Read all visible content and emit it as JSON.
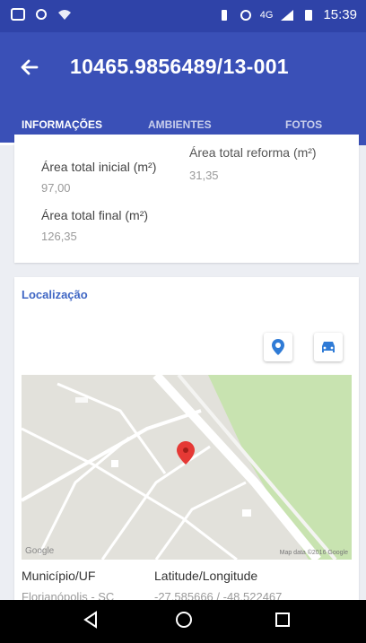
{
  "statusbar": {
    "time": "15:39",
    "network": "4G"
  },
  "appbar": {
    "back_icon": "arrow-left-icon",
    "title": "10465.9856489/13-001"
  },
  "tabs": [
    {
      "label": "INFORMAÇÕES",
      "active": true
    },
    {
      "label": "AMBIENTES",
      "active": false
    },
    {
      "label": "FOTOS",
      "active": false
    }
  ],
  "info": {
    "area_reforma_label": "Área total reforma (m²)",
    "area_reforma_value": "31,35",
    "area_inicial_label": "Área total inicial (m²)",
    "area_inicial_value": "97,00",
    "area_final_label": "Área total final (m²)",
    "area_final_value": "126,35"
  },
  "location": {
    "title": "Localização",
    "pin_icon": "map-pin-icon",
    "car_icon": "car-icon",
    "google_label": "Google",
    "map_credit": "Map data ©2016 Google",
    "municipio_label": "Município/UF",
    "municipio_value": "Florianópolis - SC",
    "latlong_label": "Latitude/Longitude",
    "latlong_value": "-27.585666 / -48.522467"
  },
  "colors": {
    "primary": "#3a50b7",
    "primary_dark": "#2f43a8",
    "accent": "#3f66c4",
    "pin": "#e53935"
  }
}
